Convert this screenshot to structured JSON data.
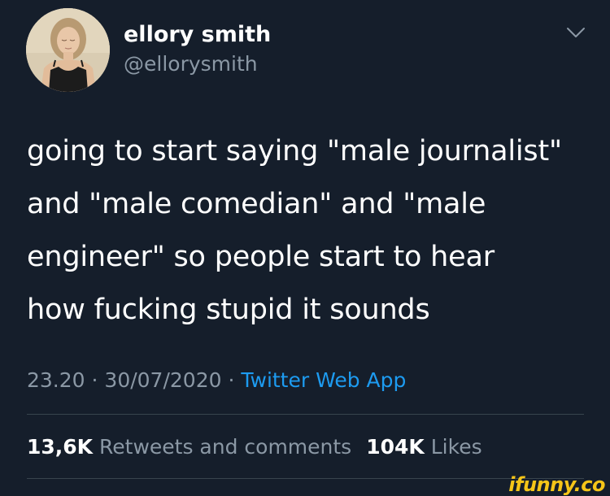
{
  "user": {
    "display_name": "ellory smith",
    "handle": "@ellorysmith"
  },
  "tweet": {
    "text": "going to start saying \"male journalist\"\nand \"male comedian\" and \"male\nengineer\" so people start to hear\nhow fucking stupid it sounds",
    "time": "23.20",
    "date": "30/07/2020",
    "separator": " · ",
    "source": "Twitter Web App"
  },
  "stats": {
    "retweets_count": "13,6K",
    "retweets_label": "Retweets and comments",
    "likes_count": "104K",
    "likes_label": "Likes"
  },
  "icons": {
    "menu": "chevron-down-icon",
    "avatar": "profile-photo"
  },
  "colors": {
    "background": "#151e2b",
    "secondary_text": "#8b98a5",
    "link": "#1d9bf0",
    "divider": "#38444d"
  },
  "watermark": {
    "text": "ifunny.co"
  }
}
